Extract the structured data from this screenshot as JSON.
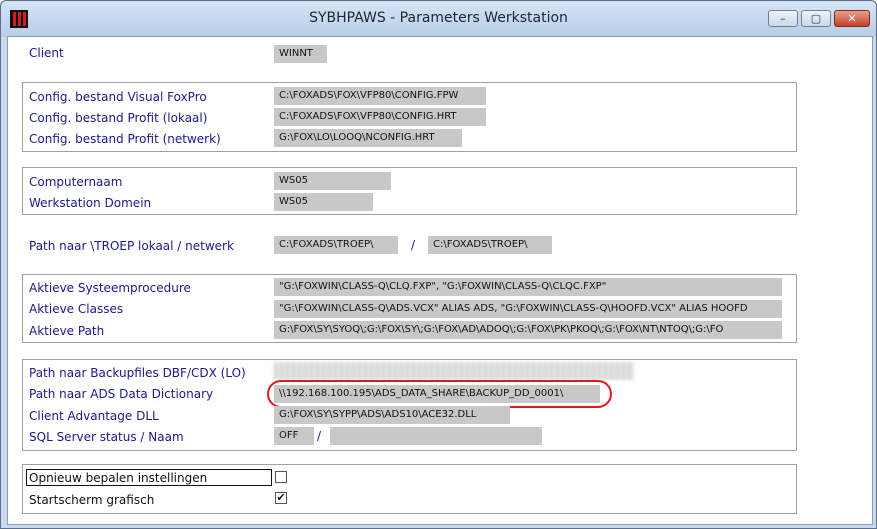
{
  "window": {
    "title": "SYBHPAWS - Parameters Werkstation",
    "minimize_glyph": "–",
    "maximize_glyph": "▢",
    "close_glyph": "✕"
  },
  "client": {
    "label": "Client",
    "value": "WINNT"
  },
  "config": {
    "visual_foxpro_label": "Config. bestand Visual FoxPro",
    "visual_foxpro_value": "C:\\FOXADS\\FOX\\VFP80\\CONFIG.FPW",
    "profit_lokaal_label": "Config. bestand Profit (lokaal)",
    "profit_lokaal_value": "C:\\FOXADS\\FOX\\VFP80\\CONFIG.HRT",
    "profit_netwerk_label": "Config. bestand Profit (netwerk)",
    "profit_netwerk_value": "G:\\FOX\\LO\\LOOQ\\NCONFIG.HRT"
  },
  "computer": {
    "name_label": "Computernaam",
    "name_value": "WS05",
    "domain_label": "Werkstation Domein",
    "domain_value": "WS05"
  },
  "troep": {
    "label": "Path naar \\TROEP lokaal / netwerk",
    "lokaal_value": "C:\\FOXADS\\TROEP\\",
    "separator": "/",
    "netwerk_value": "C:\\FOXADS\\TROEP\\"
  },
  "active": {
    "procedure_label": "Aktieve Systeemprocedure",
    "procedure_value": "\"G:\\FOXWIN\\CLASS-Q\\CLQ.FXP\", \"G:\\FOXWIN\\CLASS-Q\\CLQC.FXP\"",
    "classes_label": "Aktieve Classes",
    "classes_value": "\"G:\\FOXWIN\\CLASS-Q\\ADS.VCX\" ALIAS ADS, \"G:\\FOXWIN\\CLASS-Q\\HOOFD.VCX\" ALIAS HOOFD",
    "path_label": "Aktieve Path",
    "path_value": "G:\\FOX\\SY\\SYOQ\\;G:\\FOX\\SY\\;G:\\FOX\\AD\\ADOQ\\;G:\\FOX\\PK\\PKOQ\\;G:\\FOX\\NT\\NTOQ\\;G:\\FO"
  },
  "ads": {
    "backup_label": "Path naar Backupfiles DBF/CDX (LO)",
    "dictionary_label": "Path naar ADS Data Dictionary",
    "dictionary_value": "\\\\192.168.100.195\\ADS_DATA_SHARE\\BACKUP_DD_0001\\",
    "dll_label": "Client Advantage DLL",
    "dll_value": "G:\\FOX\\SY\\SYPP\\ADS\\ADS10\\ACE32.DLL",
    "sql_label": "SQL Server status / Naam",
    "sql_status_value": "OFF",
    "sql_separator": "/",
    "sql_name_value": ""
  },
  "options": {
    "reset_label": "Opnieuw bepalen instellingen",
    "reset_checked": false,
    "startscreen_label": "Startscherm grafisch",
    "startscreen_checked": true,
    "check_glyph": "✔"
  }
}
